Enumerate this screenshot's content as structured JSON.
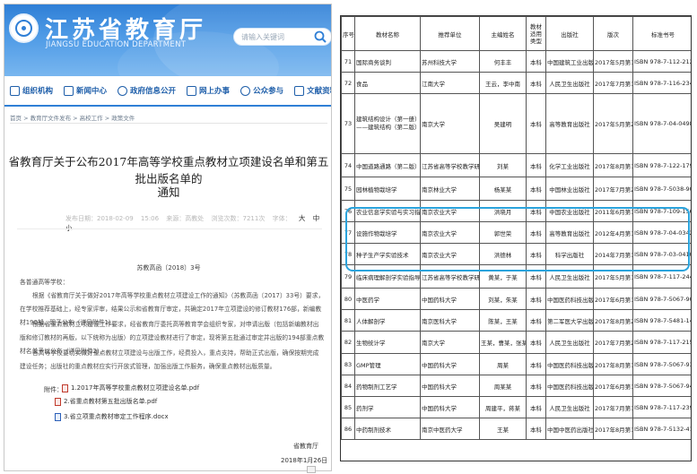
{
  "site": {
    "title_cn": "江苏省教育厅",
    "title_en": "JIANGSU EDUCATION DEPARTMENT",
    "search_placeholder": "请输入关键词"
  },
  "nav": [
    {
      "label": "组织机构",
      "icon": "building-icon"
    },
    {
      "label": "新闻中心",
      "icon": "document-icon"
    },
    {
      "label": "政府信息公开",
      "icon": "gear-icon"
    },
    {
      "label": "网上办事",
      "icon": "monitor-icon"
    },
    {
      "label": "公众参与",
      "icon": "heart-icon"
    },
    {
      "label": "文献资料",
      "icon": "folder-icon"
    }
  ],
  "breadcrumb": "首页 > 教育厅文件发布 > 高校工作 > 政策文件",
  "article": {
    "title_line1": "省教育厅关于公布2017年高等学校重点教材立项建设名单和第五批出版名单的",
    "title_line2": "通知",
    "meta": "发布日期：2018-02-09 15:06   来源：高教处   浏览次数：7211次   字体：",
    "font_size_switch": "大 中 小",
    "doc_number": "苏教高函〔2018〕3号",
    "salutation": "各普通高等学校：",
    "paragraphs": [
      "根据《省教育厅关于做好2017年高等学校重点教材立项建设工作的通知》（苏教高函〔2017〕33号）要求，在学校推荐基础上，经专家评审，结果公示和省教育厅审定，共确定2017年立项建设的修订教材176部，新编教材190部。现予公布（详见附件1）。",
      "根据省重点教材立项建设工作要求，经省教育厅委托高等教育学会组织专家，对申请出版（包括新编教材出版和修订教材的再版，以下统称为出版）的立项建设教材进行了审定，现将第五批通过审定并出版的194部重点教材名单予以公布（详见附件2）。",
      "各高等学校要切实做好重点教材立项建设与出版工作，经费投入，重点支持，帮助正式出版，确保按期完成建设任务；出版社的重点教材应实行开放式管理，加强出版工作服务，确保重点教材出版质量。"
    ],
    "attachments_label": "附件：",
    "attachments": [
      {
        "name": "1.2017年高等学校重点教材立项建设名单.pdf",
        "type": "pdf-icon"
      },
      {
        "name": "2.省重点教材第五批出版名单.pdf",
        "type": "pdf-icon"
      },
      {
        "name": "3.省立项重点教材审定工作程序.docx",
        "type": "doc-icon"
      }
    ],
    "sign_org": "省教育厅",
    "sign_date": "2018年1月26日"
  },
  "table": {
    "headers": [
      "序号",
      "教材名称",
      "推荐单位",
      "主编姓名",
      "教材适用类型",
      "出版社",
      "版次",
      "标准书号"
    ],
    "rows": [
      [
        "71",
        "国际商务谈判",
        "苏州科技大学",
        "何丰丰",
        "本科",
        "中国建筑工业出版社",
        "2017年5月第1版",
        "ISBN 978-7-112-21252-4"
      ],
      [
        "72",
        "食品",
        "江南大学",
        "王云，李中南",
        "本科",
        "人民卫生出版社",
        "2017年7月第1版",
        "ISBN 978-7-116-23482-1"
      ],
      [
        "73",
        "建筑结构设计（第一册）——建筑结构（第二版）",
        "南京大学",
        "吴建明",
        "本科",
        "高等教育出版社",
        "2017年5月第2版",
        "ISBN 978-7-04-049824-7"
      ],
      [
        "74",
        "中国道路通路（第二版）",
        "江苏省高等学校教学研究与改革中心",
        "刘某",
        "本科",
        "化学工业出版社",
        "2017年8月第1版",
        "ISBN 978-7-122-17904-1"
      ],
      [
        "75",
        "园林植物栽培学",
        "南京林业大学",
        "杨某某",
        "本科",
        "中国林业出版社",
        "2017年7月第2版",
        "ISBN 978-7-5038-9055-3"
      ],
      [
        "76",
        "农业信息学实验与实习指导",
        "南京农业大学",
        "洪晓月",
        "本科",
        "中国农业出版社",
        "2011年6月第1版",
        "ISBN 978-7-109-15625-7"
      ],
      [
        "77",
        "设施作物栽培学",
        "南京农业大学",
        "郭世荣",
        "本科",
        "高等教育出版社",
        "2012年4月第1版",
        "ISBN 978-7-04-034231-4"
      ],
      [
        "78",
        "种子生产学实验技术",
        "南京农业大学",
        "洪德林",
        "本科",
        "科学出版社",
        "2014年7月第1版",
        "ISBN 978-7-03-041089-4"
      ],
      [
        "79",
        "临床病理解剖学实验指导",
        "江苏省高等学校教学研究与改革中心",
        "黄某，于某",
        "本科",
        "人民卫生出版社",
        "2017年5月第1版",
        "ISBN 978-7-117-24497-3"
      ],
      [
        "80",
        "中医药学",
        "中国药科大学",
        "刘某，朱某",
        "本科",
        "中国医药科技出版社",
        "2017年6月第1版",
        "ISBN 978-7-5067-9048-8"
      ],
      [
        "81",
        "人体解剖学",
        "南京医科大学",
        "陈某，王某",
        "本科",
        "第二军医大学出版社",
        "2017年8月第2版",
        "ISBN 978-7-5481-1433-2"
      ],
      [
        "82",
        "生物统计学",
        "南京大学",
        "王某，曹某，张某某",
        "本科",
        "人民卫生出版社",
        "2017年7月第2版",
        "ISBN 978-7-117-21578-7"
      ],
      [
        "83",
        "GMP管理",
        "中国药科大学",
        "周某",
        "本科",
        "中国医药科技出版社",
        "2017年8月第1版",
        "ISBN 978-7-5067-9391-5"
      ],
      [
        "84",
        "药物制剂工艺学",
        "中国药科大学",
        "周某某",
        "本科",
        "中国医药科技出版社",
        "2017年6月第1版",
        "ISBN 978-7-5067-9422-6"
      ],
      [
        "85",
        "药剂学",
        "中国药科大学",
        "周建平，蒋某",
        "本科",
        "人民卫生出版社",
        "2017年7月第1版",
        "ISBN 978-7-117-23908-4"
      ],
      [
        "86",
        "中药制剂技术",
        "南京中医药大学",
        "王某",
        "本科",
        "中国中医药出版社",
        "2017年8月第1版",
        "ISBN 978-7-5132-4102-3"
      ]
    ],
    "highlight_rows": [
      "76",
      "77",
      "78"
    ],
    "highlight_color": "#2aa3dc"
  },
  "colors": {
    "banner": "#2f7fd6",
    "nav_text": "#1f5faa"
  }
}
